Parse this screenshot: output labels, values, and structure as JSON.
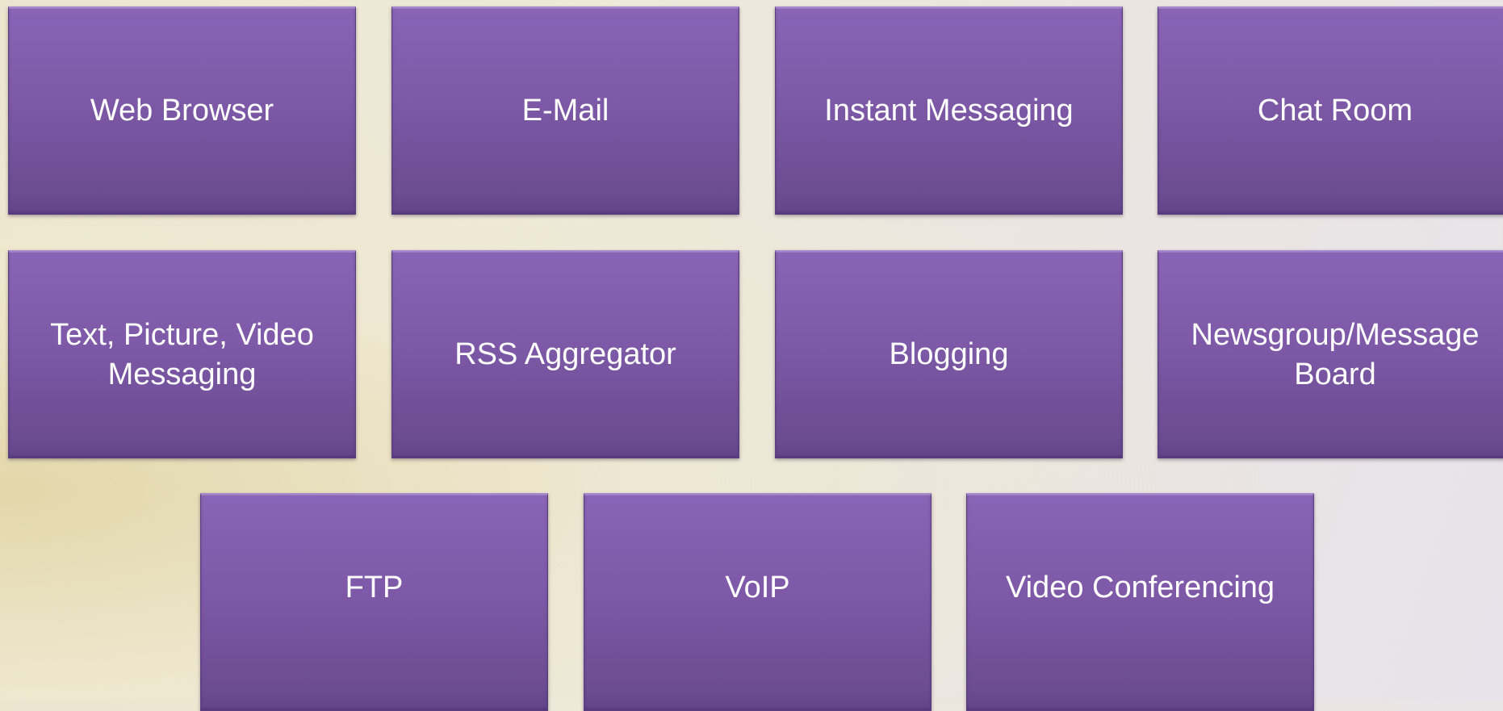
{
  "tiles": [
    {
      "label": "Web Browser"
    },
    {
      "label": "E-Mail"
    },
    {
      "label": "Instant Messaging"
    },
    {
      "label": "Chat Room"
    },
    {
      "label": "Text, Picture, Video\nMessaging"
    },
    {
      "label": "RSS Aggregator"
    },
    {
      "label": "Blogging"
    },
    {
      "label": "Newsgroup/Message\nBoard"
    },
    {
      "label": "FTP"
    },
    {
      "label": "VoIP"
    },
    {
      "label": "Video Conferencing"
    }
  ],
  "colors": {
    "tile_top": "#8a64b6",
    "tile_bottom": "#63448a",
    "text": "#ffffff"
  }
}
